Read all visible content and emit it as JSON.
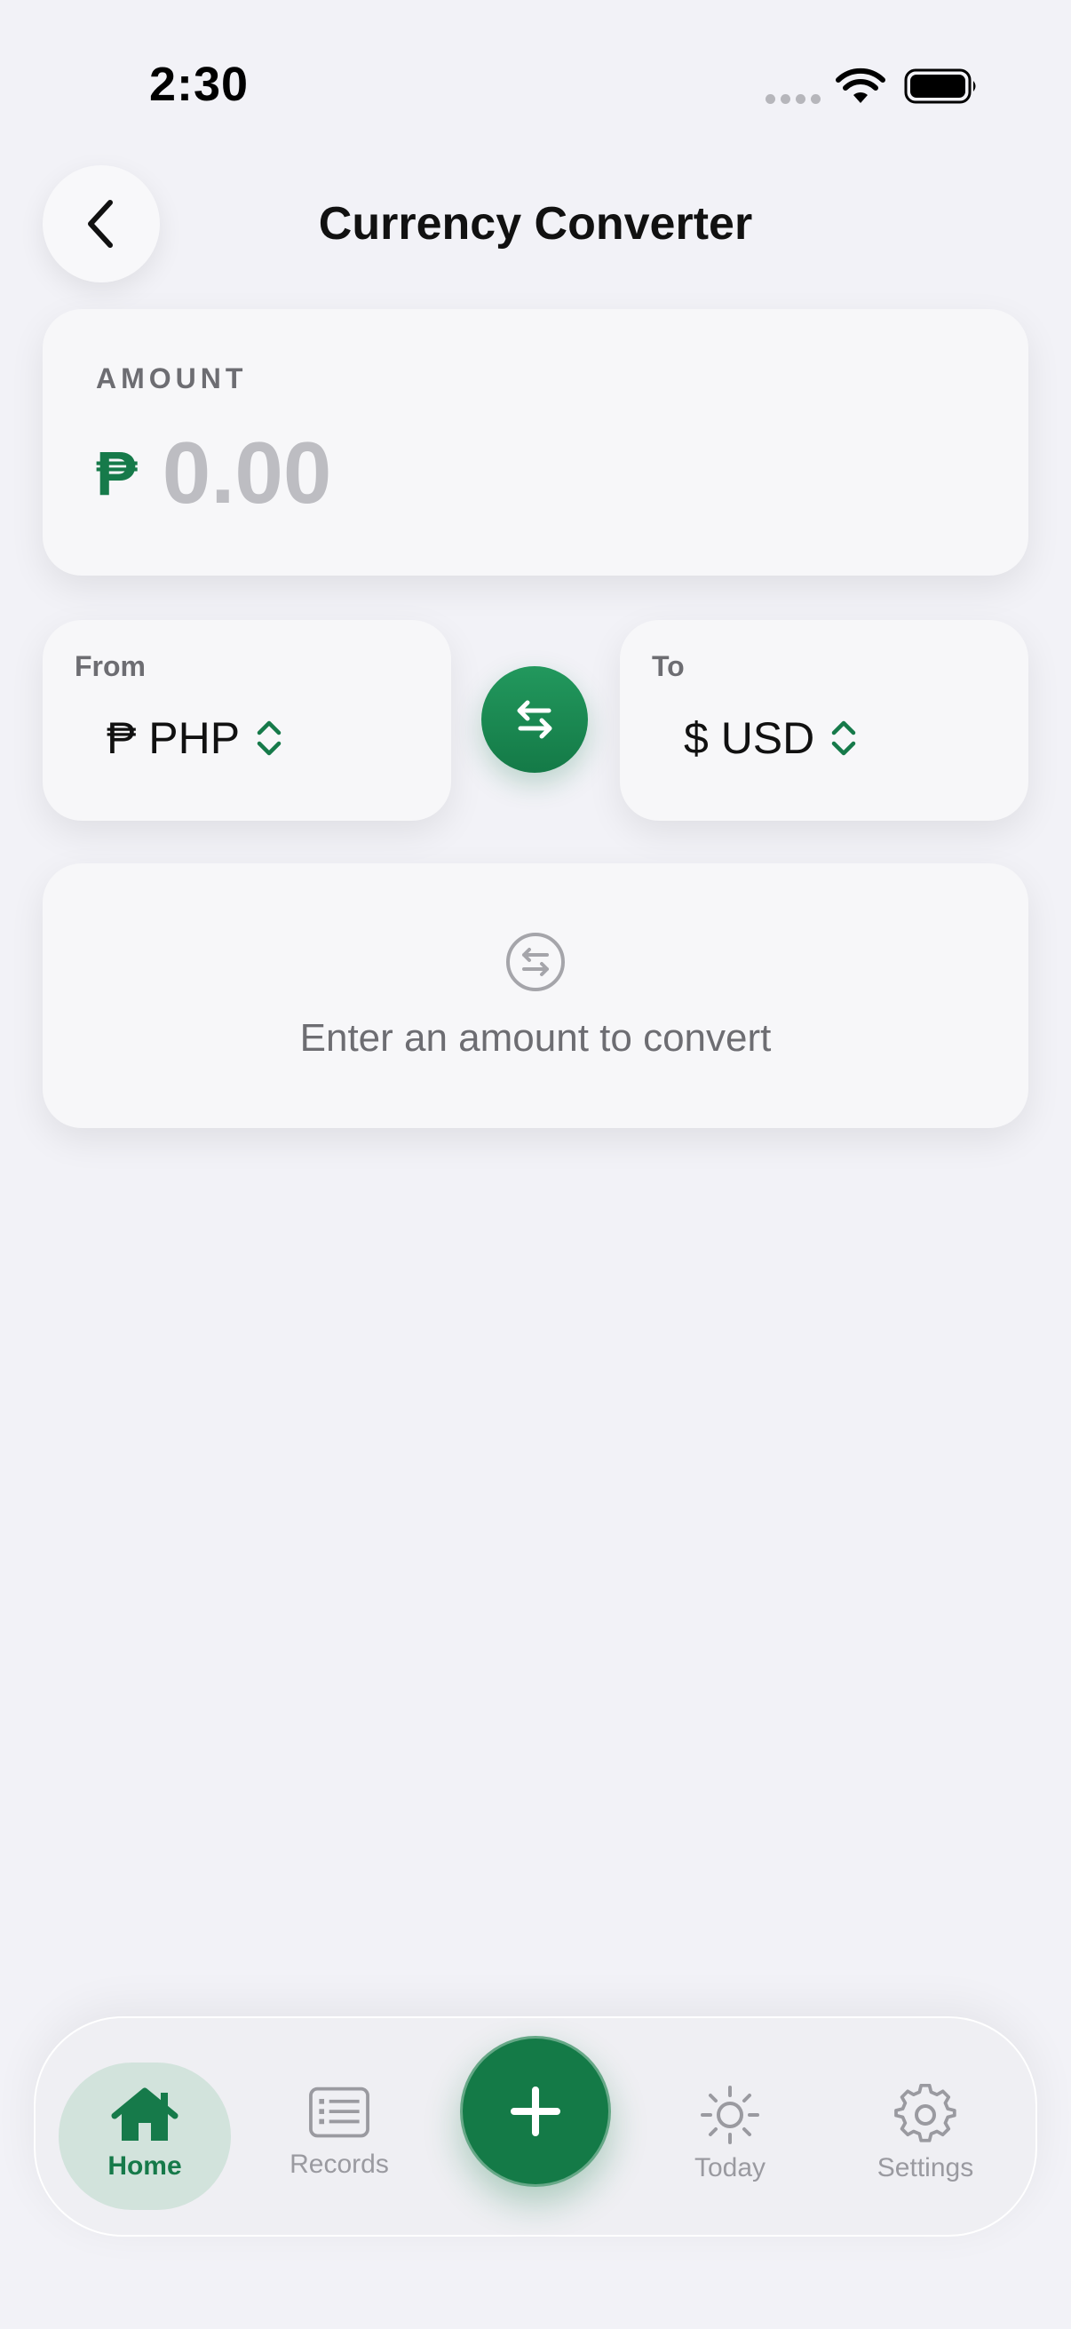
{
  "status_bar": {
    "time": "2:30"
  },
  "header": {
    "title": "Currency Converter"
  },
  "amount": {
    "label": "AMOUNT",
    "symbol": "₱",
    "value": "0.00"
  },
  "from": {
    "label": "From",
    "value": "₱ PHP"
  },
  "to": {
    "label": "To",
    "value": "$ USD"
  },
  "empty_state": {
    "message": "Enter an amount to convert"
  },
  "tabs": [
    {
      "label": "Home",
      "icon": "house-icon",
      "selected": true
    },
    {
      "label": "Records",
      "icon": "list-icon",
      "selected": false
    },
    {
      "label": "Today",
      "icon": "sun-icon",
      "selected": false
    },
    {
      "label": "Settings",
      "icon": "gear-icon",
      "selected": false
    }
  ],
  "colors": {
    "accent": "#167a4a",
    "muted": "#9a9aa0",
    "background": "#f2f2f7"
  }
}
